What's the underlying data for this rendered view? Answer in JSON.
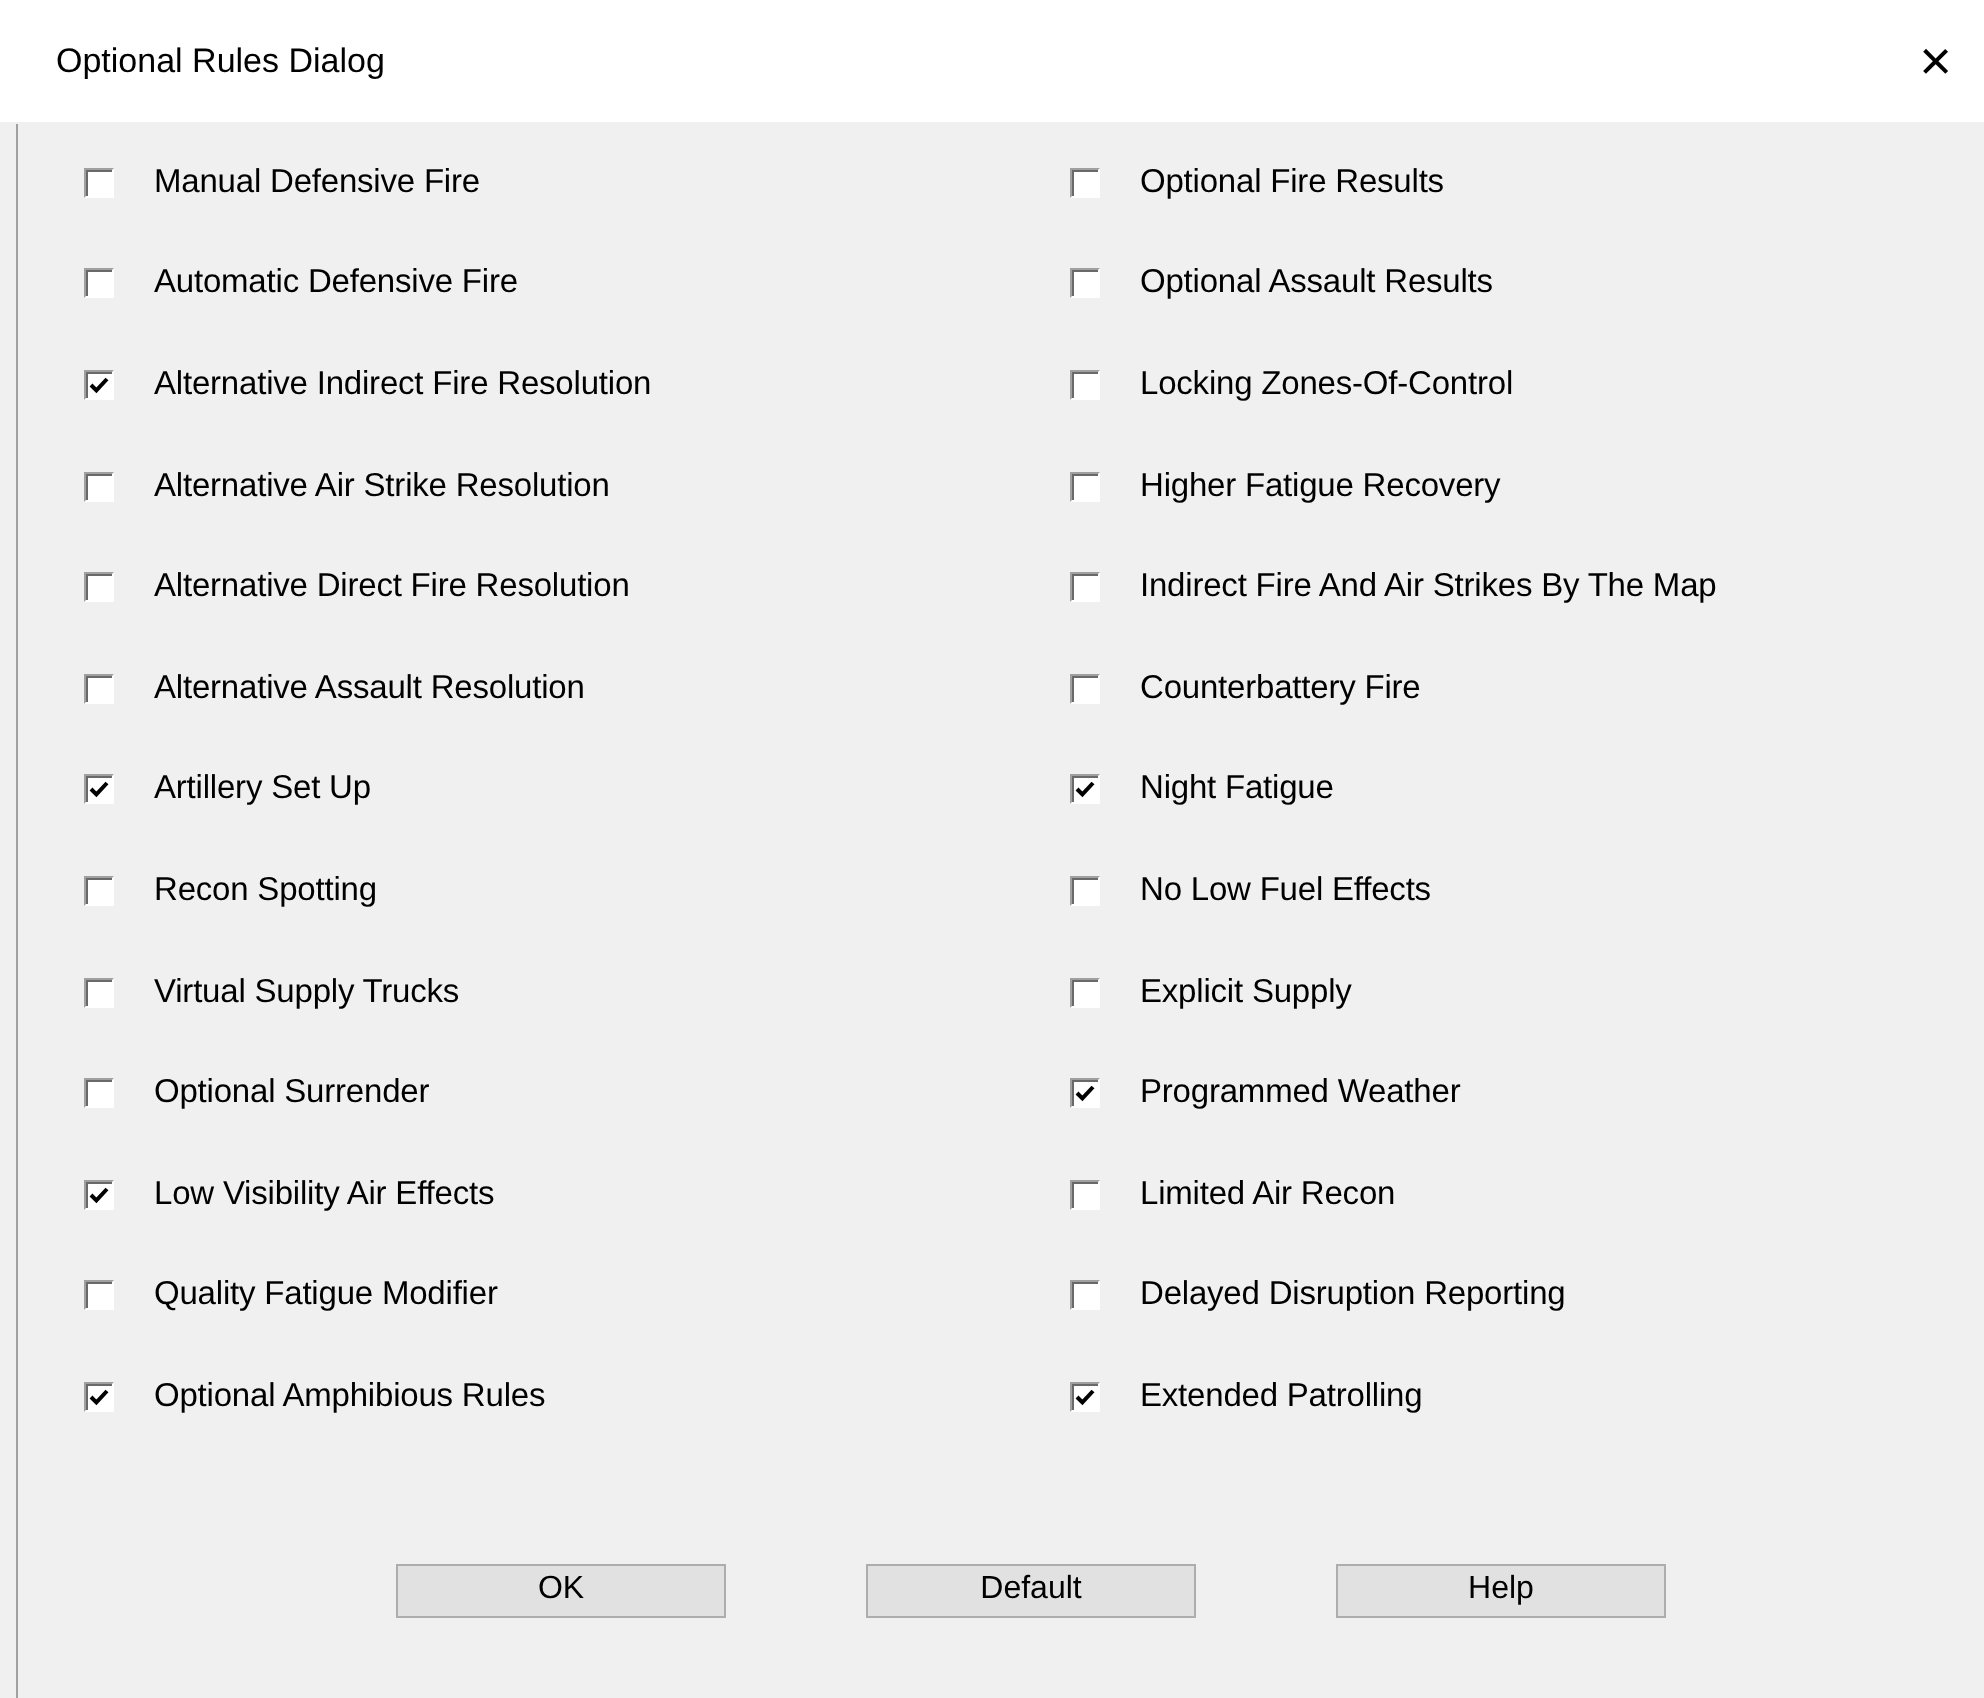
{
  "window": {
    "title": "Optional Rules Dialog",
    "close": "×"
  },
  "columns": [
    [
      {
        "label": "Manual Defensive Fire",
        "checked": false
      },
      {
        "label": "Automatic Defensive Fire",
        "checked": false
      },
      {
        "label": "Alternative Indirect Fire Resolution",
        "checked": true
      },
      {
        "label": "Alternative Air Strike Resolution",
        "checked": false
      },
      {
        "label": "Alternative Direct Fire Resolution",
        "checked": false
      },
      {
        "label": "Alternative Assault Resolution",
        "checked": false
      },
      {
        "label": "Artillery Set Up",
        "checked": true
      },
      {
        "label": "Recon Spotting",
        "checked": false
      },
      {
        "label": "Virtual Supply Trucks",
        "checked": false
      },
      {
        "label": "Optional Surrender",
        "checked": false
      },
      {
        "label": "Low Visibility Air Effects",
        "checked": true
      },
      {
        "label": "Quality Fatigue Modifier",
        "checked": false
      },
      {
        "label": "Optional Amphibious Rules",
        "checked": true
      }
    ],
    [
      {
        "label": "Optional Fire Results",
        "checked": false
      },
      {
        "label": "Optional Assault Results",
        "checked": false
      },
      {
        "label": "Locking Zones-Of-Control",
        "checked": false
      },
      {
        "label": "Higher Fatigue Recovery",
        "checked": false
      },
      {
        "label": "Indirect Fire And Air Strikes By The Map",
        "checked": false
      },
      {
        "label": "Counterbattery Fire",
        "checked": false
      },
      {
        "label": "Night Fatigue",
        "checked": true
      },
      {
        "label": "No Low Fuel Effects",
        "checked": false
      },
      {
        "label": "Explicit Supply",
        "checked": false
      },
      {
        "label": "Programmed Weather",
        "checked": true
      },
      {
        "label": "Limited Air Recon",
        "checked": false
      },
      {
        "label": "Delayed Disruption Reporting",
        "checked": false
      },
      {
        "label": "Extended Patrolling",
        "checked": true
      }
    ]
  ],
  "buttons": [
    "OK",
    "Default",
    "Help"
  ]
}
